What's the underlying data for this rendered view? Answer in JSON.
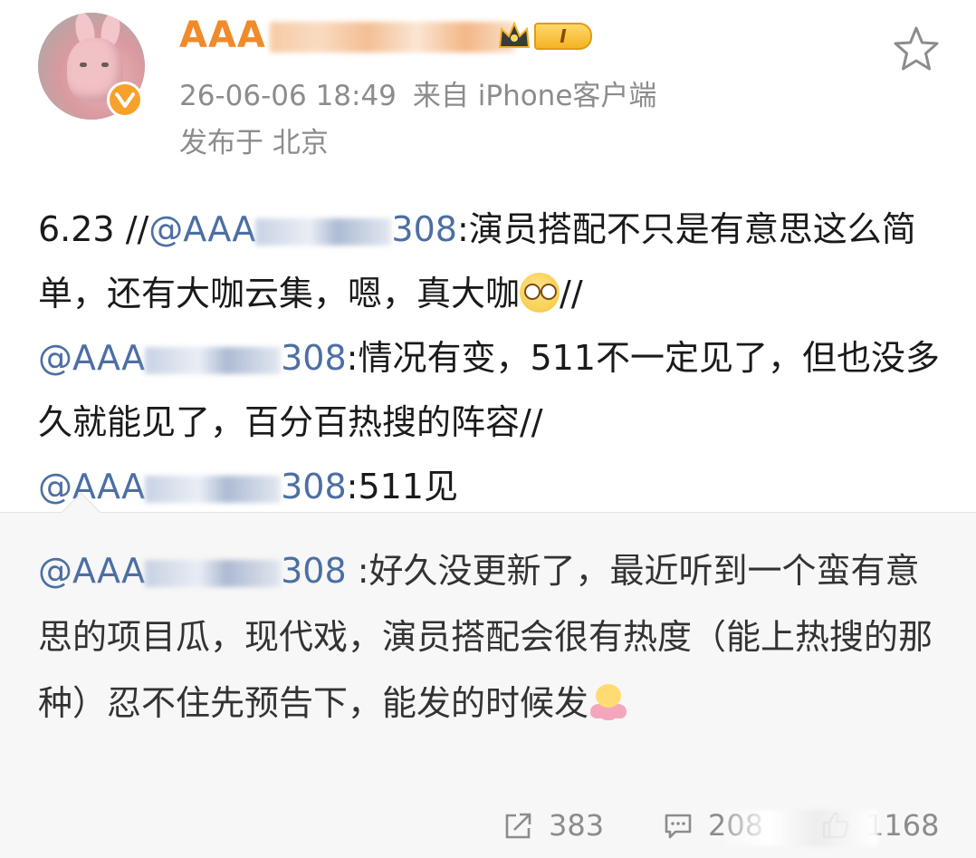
{
  "post": {
    "username": "AAA",
    "level": "I",
    "timestamp": "26-06-06 18:49",
    "source_prefix": "来自",
    "source": "iPhone客户端",
    "location": "发布于 北京",
    "content": {
      "part1": "6.23 //",
      "mention1_start": "@AAA",
      "mention1_end": "308",
      "text1": ":演员搭配不只是有意思这么简单，还有大咖云集，嗯，真大咖",
      "slash1": "//",
      "mention2_start": "@AAA",
      "mention2_end": "308",
      "text2": ":情况有变，511不一定见了，但也没多久就能见了，百分百热搜的阵容//",
      "mention3_start": "@AAA",
      "mention3_end": "308",
      "text3": ":511见"
    }
  },
  "repost": {
    "mention_start": "@AAA",
    "mention_end": "308",
    "text": " :好久没更新了，最近听到一个蛮有意思的项目瓜，现代戏，演员搭配会很有热度（能上热搜的那种）忍不住先预告下，能发的时候发"
  },
  "actions": {
    "share_count": "383",
    "comment_count": "208",
    "like_count": "1168"
  },
  "colors": {
    "username": "#f08a2a",
    "mention": "#4c6fa3",
    "meta": "#8c8c8c",
    "repost_bg": "#f7f7f7"
  }
}
